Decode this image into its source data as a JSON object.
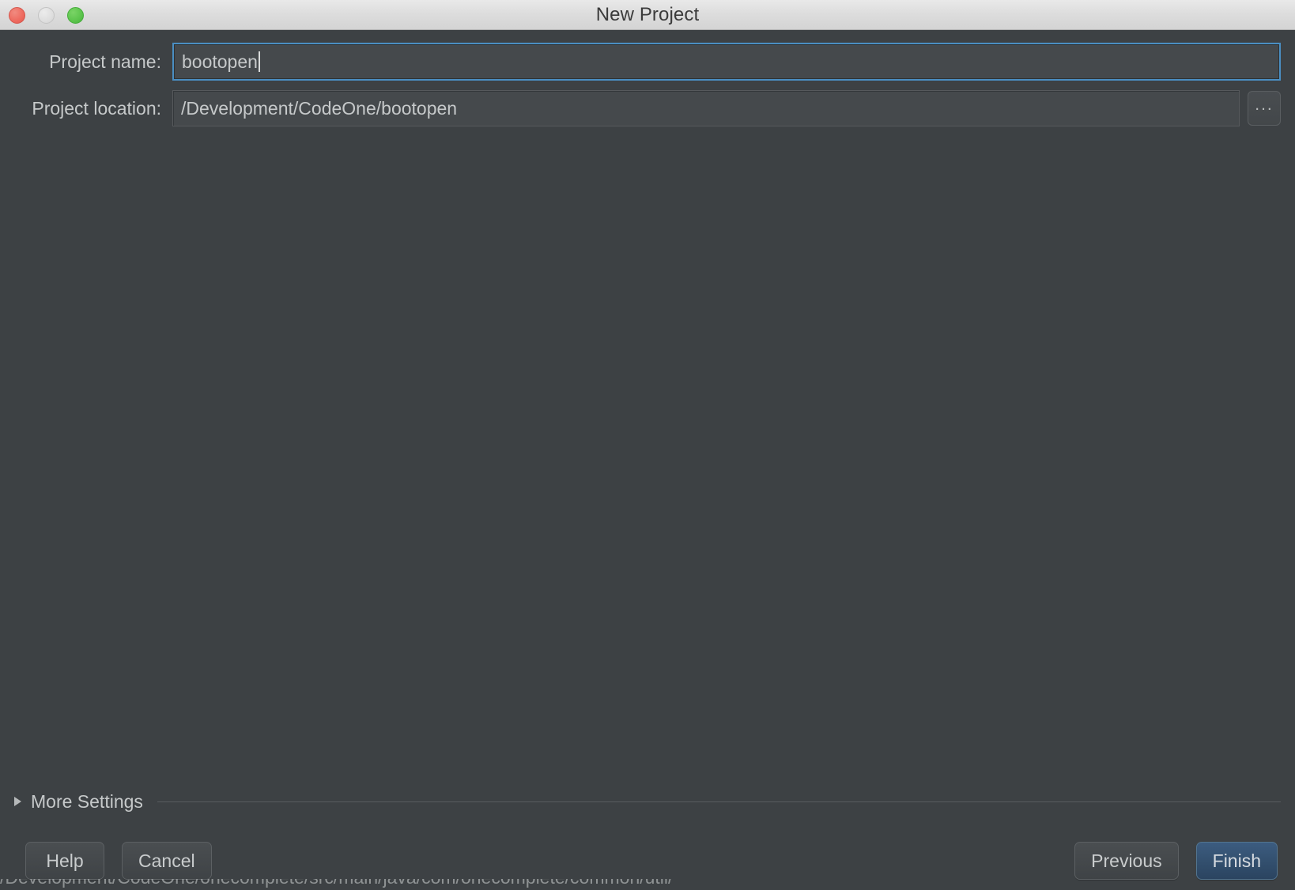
{
  "titlebar": {
    "title": "New Project",
    "controls": {
      "close": "close-button",
      "minimize": "minimize-button",
      "zoom": "zoom-button"
    }
  },
  "form": {
    "project_name": {
      "label": "Project name:",
      "value": "bootopen",
      "placeholder": "",
      "focused": true
    },
    "project_location": {
      "label": "Project location:",
      "value": "/Development/CodeOne/bootopen",
      "placeholder": "",
      "browse_label": "..."
    }
  },
  "more_settings": {
    "label": "More Settings",
    "expanded": false
  },
  "buttons": {
    "help": "Help",
    "cancel": "Cancel",
    "previous": "Previous",
    "finish": "Finish"
  },
  "background_text": {
    "clipped_line": "/Development/CodeOne/onecomplete/src/main/java/com/onecomplete/common/util/"
  },
  "colors": {
    "window_background": "#3d4144",
    "titlebar_top": "#e9e9e9",
    "field_background": "#45494c",
    "focus_border": "#4a8ec2",
    "default_button": "#33506f",
    "text_primary": "#c6c9ca",
    "close_red": "#ee6a5f",
    "minimize_gray": "#dedede",
    "zoom_green": "#5cc44c"
  }
}
